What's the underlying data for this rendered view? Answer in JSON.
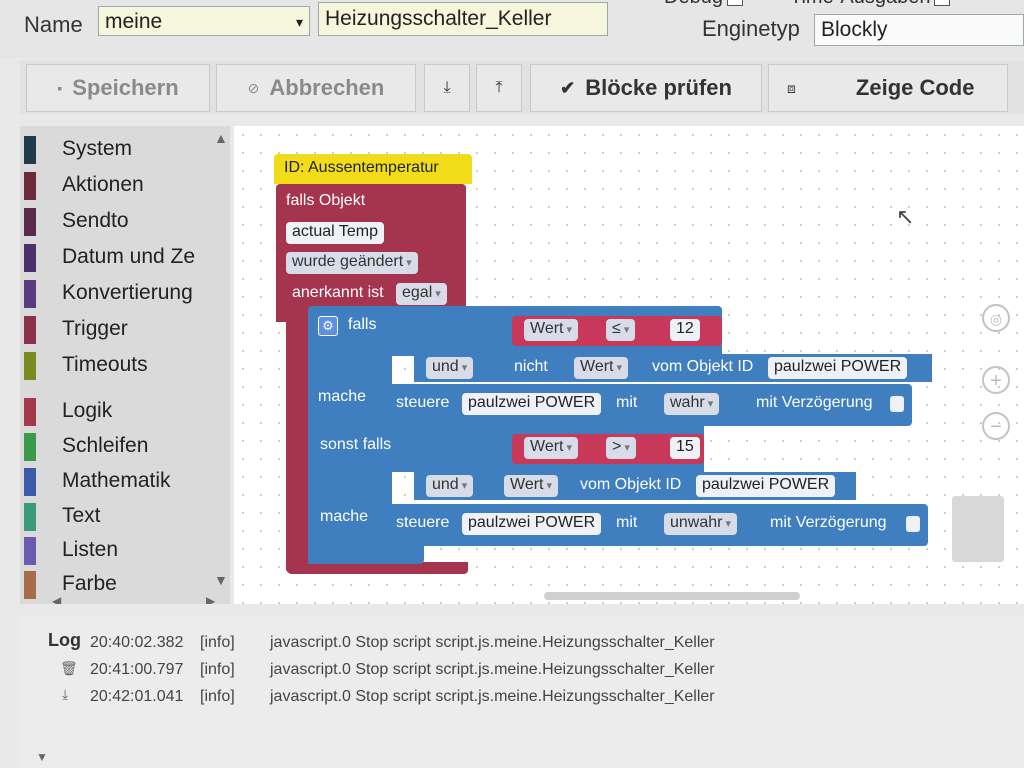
{
  "header": {
    "name_label": "Name",
    "folder_value": "meine",
    "script_name": "Heizungsschalter_Keller",
    "debug_label": "Debug",
    "verbose_label": "Time-Ausgaben",
    "engine_label": "Enginetyp",
    "engine_value": "Blockly"
  },
  "toolbar": {
    "save": "Speichern",
    "cancel": "Abbrechen",
    "check": "Blöcke prüfen",
    "show_code": "Zeige Code"
  },
  "sidebar": {
    "categories": [
      {
        "label": "System",
        "color": "#1f3a4a"
      },
      {
        "label": "Aktionen",
        "color": "#6b2a3a"
      },
      {
        "label": "Sendto",
        "color": "#5a2a4a"
      },
      {
        "label": "Datum und Ze",
        "color": "#4a2f6b"
      },
      {
        "label": "Konvertierung",
        "color": "#5b3b80"
      },
      {
        "label": "Trigger",
        "color": "#8a3048"
      },
      {
        "label": "Timeouts",
        "color": "#7a8a20"
      },
      {
        "label": "Logik",
        "color": "#a3384a"
      },
      {
        "label": "Schleifen",
        "color": "#3a9a4a"
      },
      {
        "label": "Mathematik",
        "color": "#3a5aaa"
      },
      {
        "label": "Text",
        "color": "#3a9a7a"
      },
      {
        "label": "Listen",
        "color": "#6a5ab0"
      },
      {
        "label": "Farbe",
        "color": "#a86a4a"
      }
    ]
  },
  "workspace": {
    "trigger_id": "ID: Aussentemperatur",
    "falls_objekt": "falls Objekt",
    "object_name": "actual Temp",
    "changed": "wurde geändert",
    "ack_label": "anerkannt ist",
    "ack_value": "egal",
    "if_label": "falls",
    "do_label": "mache",
    "elseif_label": "sonst falls",
    "cond1": {
      "field": "Wert",
      "op": "≤",
      "value": "12"
    },
    "cond2": {
      "field": "Wert",
      "op": ">",
      "value": "15"
    },
    "and_label": "und",
    "not_label": "nicht",
    "from_object": "vom Objekt ID",
    "target_object": "paulzwei POWER",
    "control_label": "steuere",
    "with_label": "mit",
    "true_value": "wahr",
    "false_value": "unwahr",
    "delay_label": "mit Verzögerung"
  },
  "log": {
    "label": "Log",
    "entries": [
      {
        "time": "20:40:02.382",
        "level": "[info]",
        "message": "javascript.0 Stop script script.js.meine.Heizungsschalter_Keller"
      },
      {
        "time": "20:41:00.797",
        "level": "[info]",
        "message": "javascript.0 Stop script script.js.meine.Heizungsschalter_Keller"
      },
      {
        "time": "20:42:01.041",
        "level": "[info]",
        "message": "javascript.0 Stop script script.js.meine.Heizungsschalter_Keller"
      }
    ]
  },
  "colors": {
    "trigger_block": "#a5344f",
    "logic_block": "#3f7fbf",
    "id_block": "#f1dc1a",
    "compare_block": "#c8385a"
  }
}
